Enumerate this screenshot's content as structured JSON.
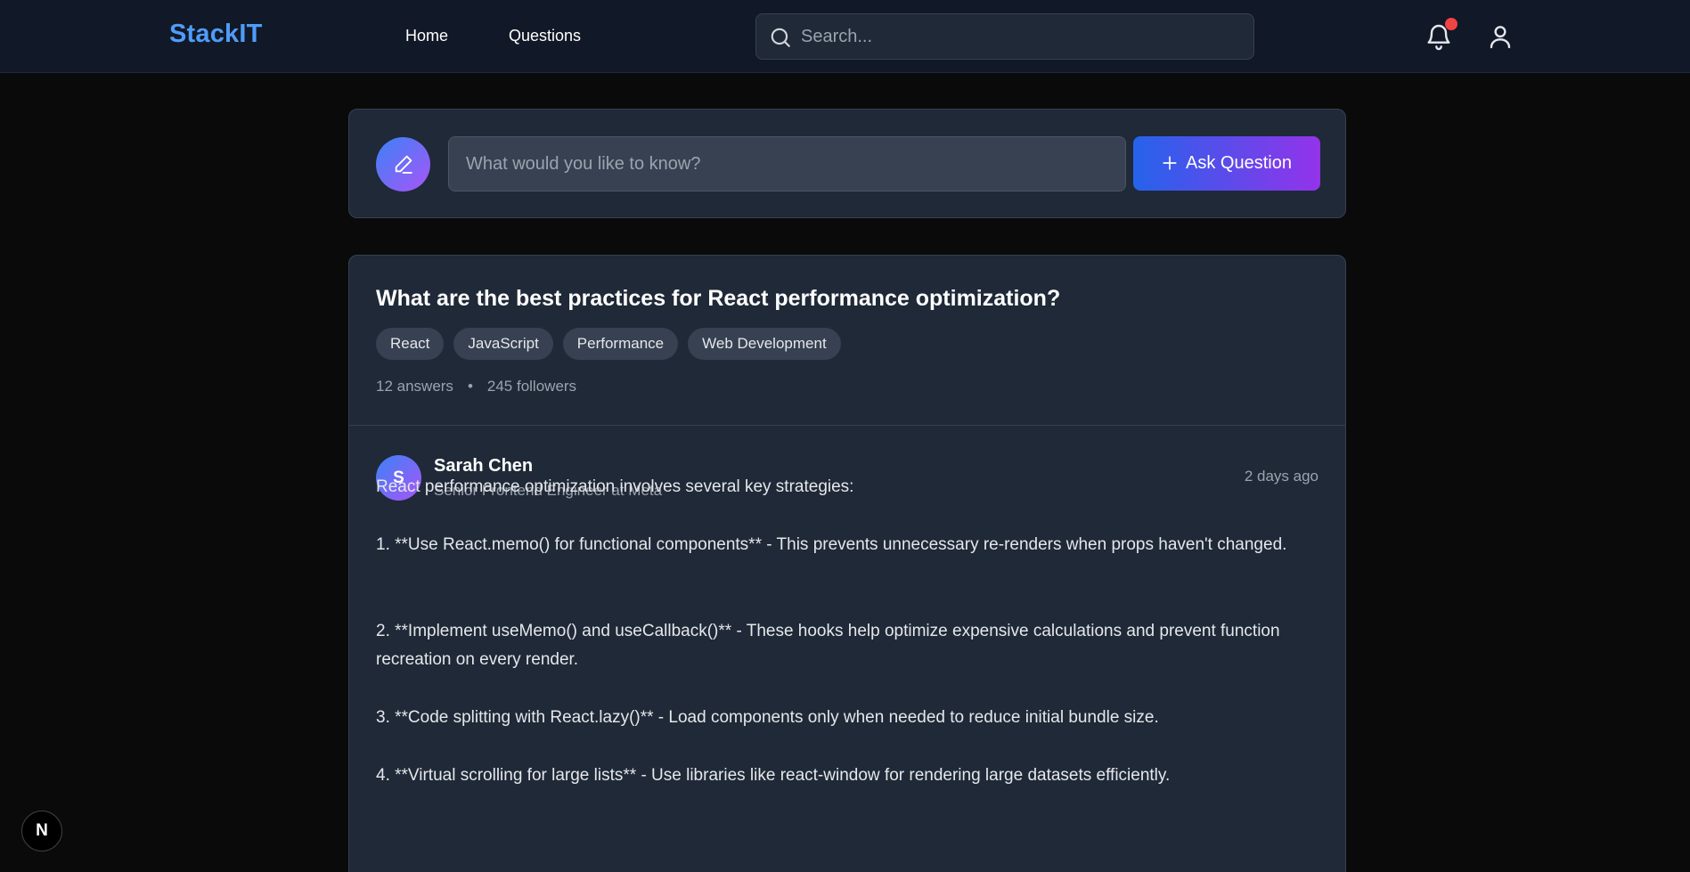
{
  "header": {
    "brand": "StackIT",
    "nav": {
      "home": "Home",
      "questions": "Questions"
    },
    "search": {
      "placeholder": "Search..."
    },
    "icons": {
      "notifications": "bell-icon",
      "notification_dot_color": "#ef4444",
      "user": "user-icon"
    }
  },
  "ask": {
    "avatar_icon": "pencil-icon",
    "placeholder": "What would you like to know?",
    "button_label": "Ask Question",
    "button_icon": "plus-icon"
  },
  "question": {
    "title": "What are the best practices for React performance optimization?",
    "tags": [
      "React",
      "JavaScript",
      "Performance",
      "Web Development"
    ],
    "answers_count": "12 answers",
    "separator": "•",
    "followers_count": "245 followers"
  },
  "answer": {
    "avatar_initial": "S",
    "author": "Sarah Chen",
    "role": "Senior Frontend Engineer at Meta",
    "time": "2 days ago",
    "lines": [
      "React performance optimization involves several key strategies:",
      "1. **Use React.memo() for functional components** - This prevents unnecessary re-renders when props haven't changed.",
      "2. **Implement useMemo() and useCallback()** - These hooks help optimize expensive calculations and prevent function recreation on every render.",
      "3. **Code splitting with React.lazy()** - Load components only when needed to reduce initial bundle size.",
      "4. **Virtual scrolling for large lists** - Use libraries like react-window for rendering large datasets efficiently."
    ]
  },
  "badge": {
    "label": "N"
  },
  "colors": {
    "brand": "#4f9cf9",
    "accent_gradient_start": "#2563eb",
    "accent_gradient_end": "#9333ea"
  }
}
